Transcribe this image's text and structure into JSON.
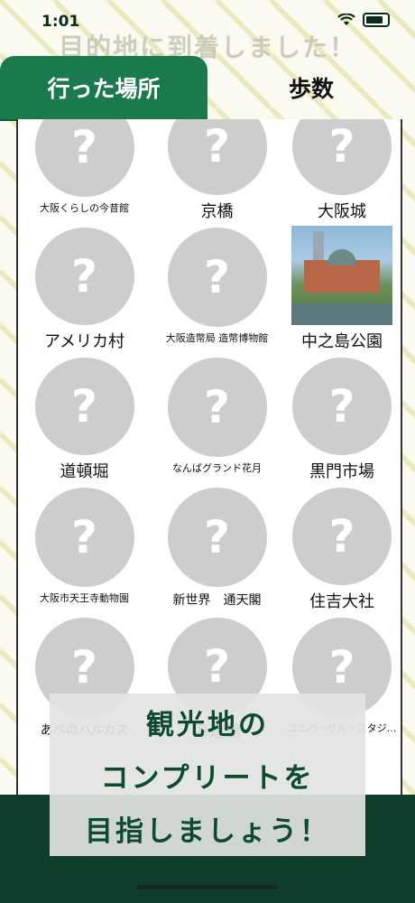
{
  "status": {
    "time": "1:01"
  },
  "banner": {
    "text": "目的地に到着しました！"
  },
  "tabs": {
    "visited": "行った場所",
    "steps": "歩数"
  },
  "places": [
    {
      "name": "大阪くらしの今昔館",
      "size": "sm",
      "image": "unknown",
      "mark": "?"
    },
    {
      "name": "京橋",
      "size": "lg",
      "image": "unknown",
      "mark": "?"
    },
    {
      "name": "大阪城",
      "size": "lg",
      "image": "unknown",
      "mark": "?"
    },
    {
      "name": "アメリカ村",
      "size": "lg",
      "image": "unknown",
      "mark": "?"
    },
    {
      "name": "大阪造幣局 造幣博物館",
      "size": "sm",
      "image": "unknown",
      "mark": "?"
    },
    {
      "name": "中之島公園",
      "size": "lg",
      "image": "photo",
      "mark": ""
    },
    {
      "name": "道頓堀",
      "size": "lg",
      "image": "unknown",
      "mark": "?"
    },
    {
      "name": "なんばグランド花月",
      "size": "sm",
      "image": "unknown",
      "mark": "?"
    },
    {
      "name": "黒門市場",
      "size": "lg",
      "image": "unknown",
      "mark": "?"
    },
    {
      "name": "大阪市天王寺動物園",
      "size": "sm",
      "image": "unknown",
      "mark": "?"
    },
    {
      "name": "新世界　通天閣",
      "size": "md",
      "image": "unknown",
      "mark": "?"
    },
    {
      "name": "住吉大社",
      "size": "lg",
      "image": "unknown",
      "mark": "?"
    },
    {
      "name": "あべのハルカス",
      "size": "md",
      "image": "unknown",
      "mark": "?"
    },
    {
      "name": "海遊館",
      "size": "lg",
      "image": "unknown",
      "mark": "?"
    },
    {
      "name": "ユニバーサル・スタジ...",
      "size": "sm",
      "image": "unknown",
      "mark": "?"
    }
  ],
  "overlay": {
    "line1": "観光地の",
    "line2": "コンプリートを",
    "line3": "目指しましょう！"
  },
  "colors": {
    "accent": "#1a7a4e",
    "dark_green": "#0e3d2c",
    "placeholder": "#cdcdcd"
  }
}
